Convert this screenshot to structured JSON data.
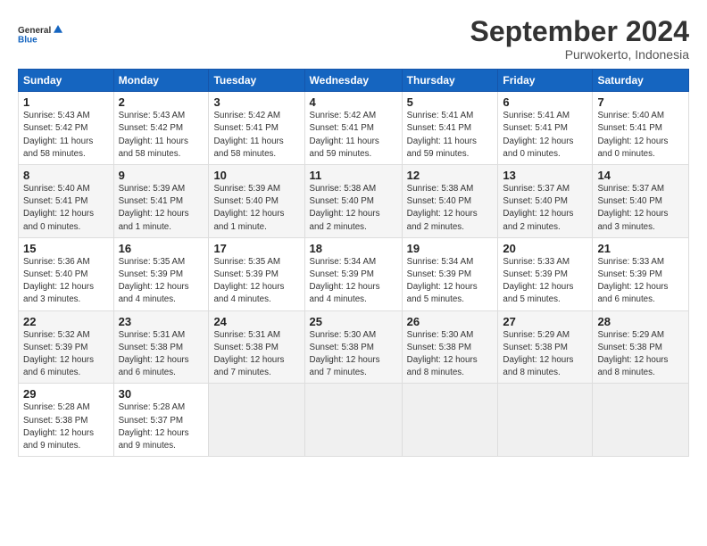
{
  "header": {
    "logo_line1": "General",
    "logo_line2": "Blue",
    "month": "September 2024",
    "location": "Purwokerto, Indonesia"
  },
  "weekdays": [
    "Sunday",
    "Monday",
    "Tuesday",
    "Wednesday",
    "Thursday",
    "Friday",
    "Saturday"
  ],
  "weeks": [
    [
      {
        "day": "1",
        "info": "Sunrise: 5:43 AM\nSunset: 5:42 PM\nDaylight: 11 hours\nand 58 minutes."
      },
      {
        "day": "2",
        "info": "Sunrise: 5:43 AM\nSunset: 5:42 PM\nDaylight: 11 hours\nand 58 minutes."
      },
      {
        "day": "3",
        "info": "Sunrise: 5:42 AM\nSunset: 5:41 PM\nDaylight: 11 hours\nand 58 minutes."
      },
      {
        "day": "4",
        "info": "Sunrise: 5:42 AM\nSunset: 5:41 PM\nDaylight: 11 hours\nand 59 minutes."
      },
      {
        "day": "5",
        "info": "Sunrise: 5:41 AM\nSunset: 5:41 PM\nDaylight: 11 hours\nand 59 minutes."
      },
      {
        "day": "6",
        "info": "Sunrise: 5:41 AM\nSunset: 5:41 PM\nDaylight: 12 hours\nand 0 minutes."
      },
      {
        "day": "7",
        "info": "Sunrise: 5:40 AM\nSunset: 5:41 PM\nDaylight: 12 hours\nand 0 minutes."
      }
    ],
    [
      {
        "day": "8",
        "info": "Sunrise: 5:40 AM\nSunset: 5:41 PM\nDaylight: 12 hours\nand 0 minutes."
      },
      {
        "day": "9",
        "info": "Sunrise: 5:39 AM\nSunset: 5:41 PM\nDaylight: 12 hours\nand 1 minute."
      },
      {
        "day": "10",
        "info": "Sunrise: 5:39 AM\nSunset: 5:40 PM\nDaylight: 12 hours\nand 1 minute."
      },
      {
        "day": "11",
        "info": "Sunrise: 5:38 AM\nSunset: 5:40 PM\nDaylight: 12 hours\nand 2 minutes."
      },
      {
        "day": "12",
        "info": "Sunrise: 5:38 AM\nSunset: 5:40 PM\nDaylight: 12 hours\nand 2 minutes."
      },
      {
        "day": "13",
        "info": "Sunrise: 5:37 AM\nSunset: 5:40 PM\nDaylight: 12 hours\nand 2 minutes."
      },
      {
        "day": "14",
        "info": "Sunrise: 5:37 AM\nSunset: 5:40 PM\nDaylight: 12 hours\nand 3 minutes."
      }
    ],
    [
      {
        "day": "15",
        "info": "Sunrise: 5:36 AM\nSunset: 5:40 PM\nDaylight: 12 hours\nand 3 minutes."
      },
      {
        "day": "16",
        "info": "Sunrise: 5:35 AM\nSunset: 5:39 PM\nDaylight: 12 hours\nand 4 minutes."
      },
      {
        "day": "17",
        "info": "Sunrise: 5:35 AM\nSunset: 5:39 PM\nDaylight: 12 hours\nand 4 minutes."
      },
      {
        "day": "18",
        "info": "Sunrise: 5:34 AM\nSunset: 5:39 PM\nDaylight: 12 hours\nand 4 minutes."
      },
      {
        "day": "19",
        "info": "Sunrise: 5:34 AM\nSunset: 5:39 PM\nDaylight: 12 hours\nand 5 minutes."
      },
      {
        "day": "20",
        "info": "Sunrise: 5:33 AM\nSunset: 5:39 PM\nDaylight: 12 hours\nand 5 minutes."
      },
      {
        "day": "21",
        "info": "Sunrise: 5:33 AM\nSunset: 5:39 PM\nDaylight: 12 hours\nand 6 minutes."
      }
    ],
    [
      {
        "day": "22",
        "info": "Sunrise: 5:32 AM\nSunset: 5:39 PM\nDaylight: 12 hours\nand 6 minutes."
      },
      {
        "day": "23",
        "info": "Sunrise: 5:31 AM\nSunset: 5:38 PM\nDaylight: 12 hours\nand 6 minutes."
      },
      {
        "day": "24",
        "info": "Sunrise: 5:31 AM\nSunset: 5:38 PM\nDaylight: 12 hours\nand 7 minutes."
      },
      {
        "day": "25",
        "info": "Sunrise: 5:30 AM\nSunset: 5:38 PM\nDaylight: 12 hours\nand 7 minutes."
      },
      {
        "day": "26",
        "info": "Sunrise: 5:30 AM\nSunset: 5:38 PM\nDaylight: 12 hours\nand 8 minutes."
      },
      {
        "day": "27",
        "info": "Sunrise: 5:29 AM\nSunset: 5:38 PM\nDaylight: 12 hours\nand 8 minutes."
      },
      {
        "day": "28",
        "info": "Sunrise: 5:29 AM\nSunset: 5:38 PM\nDaylight: 12 hours\nand 8 minutes."
      }
    ],
    [
      {
        "day": "29",
        "info": "Sunrise: 5:28 AM\nSunset: 5:38 PM\nDaylight: 12 hours\nand 9 minutes."
      },
      {
        "day": "30",
        "info": "Sunrise: 5:28 AM\nSunset: 5:37 PM\nDaylight: 12 hours\nand 9 minutes."
      },
      {
        "day": "",
        "info": ""
      },
      {
        "day": "",
        "info": ""
      },
      {
        "day": "",
        "info": ""
      },
      {
        "day": "",
        "info": ""
      },
      {
        "day": "",
        "info": ""
      }
    ]
  ]
}
